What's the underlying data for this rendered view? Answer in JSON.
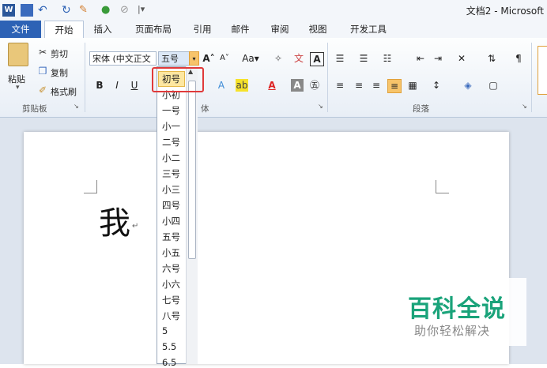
{
  "title": "文档2 - Microsoft",
  "tabs": [
    "文件",
    "开始",
    "插入",
    "页面布局",
    "引用",
    "邮件",
    "审阅",
    "视图",
    "开发工具"
  ],
  "clipboard": {
    "paste": "粘贴",
    "cut": "剪切",
    "copy": "复制",
    "format_painter": "格式刷",
    "group": "剪贴板"
  },
  "font": {
    "name": "宋体 (中文正文",
    "size": "五号",
    "group": "体"
  },
  "paragraph": {
    "group": "段落"
  },
  "format_buttons": {
    "bold": "B",
    "italic": "I",
    "underline": "U"
  },
  "document": {
    "text": "我",
    "para_mark": "↵"
  },
  "size_list": {
    "selected": "初号",
    "items": [
      "小初",
      "一号",
      "小一",
      "二号",
      "小二",
      "三号",
      "小三",
      "四号",
      "小四",
      "五号",
      "小五",
      "六号",
      "小六",
      "七号",
      "八号",
      "5",
      "5.5",
      "6.5"
    ]
  },
  "watermark": {
    "title": "百科全说",
    "subtitle": "助你轻松解决"
  },
  "colors": {
    "file_tab": "#2d62b5",
    "highlight": "#e03a3a",
    "watermark": "#1aa37a"
  }
}
